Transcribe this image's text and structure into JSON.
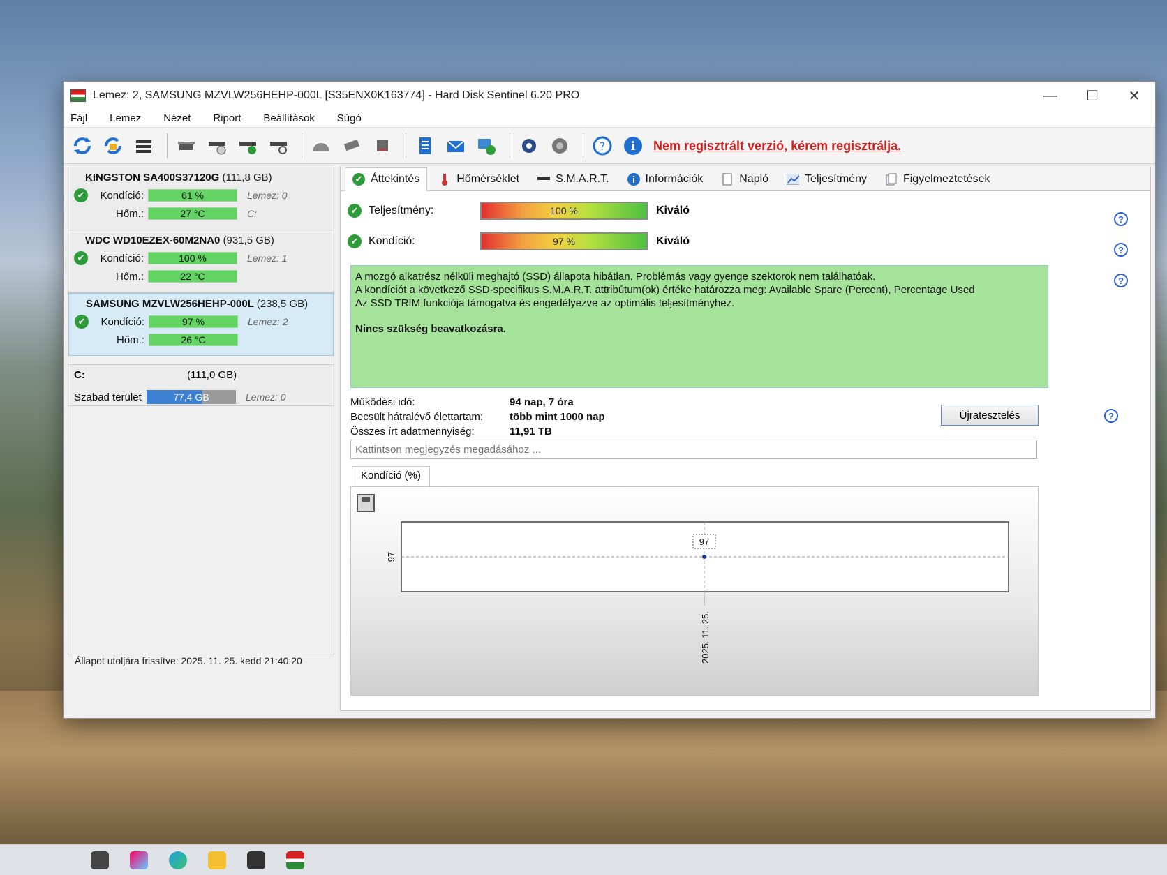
{
  "window": {
    "title": "Lemez: 2, SAMSUNG MZVLW256HEHP-000L [S35ENX0K163774]  -  Hard Disk Sentinel 6.20 PRO",
    "minimize": "—",
    "maximize": "☐",
    "close": "✕"
  },
  "menu": [
    "Fájl",
    "Lemez",
    "Nézet",
    "Riport",
    "Beállítások",
    "Súgó"
  ],
  "toolbar": {
    "registration_notice": "Nem regisztrált verzió, kérem regisztrálja."
  },
  "disks": [
    {
      "name": "KINGSTON SA400S37120G",
      "size": "(111,8 GB)",
      "condition_label": "Kondíció:",
      "condition": "61 %",
      "temp_label": "Hőm.:",
      "temp": "27 °C",
      "disk_meta": "Lemez: 0",
      "drive_meta": "C:"
    },
    {
      "name": "WDC WD10EZEX-60M2NA0",
      "size": "(931,5 GB)",
      "condition_label": "Kondíció:",
      "condition": "100 %",
      "temp_label": "Hőm.:",
      "temp": "22 °C",
      "disk_meta": "Lemez: 1",
      "drive_meta": ""
    },
    {
      "name": "SAMSUNG MZVLW256HEHP-000L",
      "size": "(238,5 GB)",
      "condition_label": "Kondíció:",
      "condition": "97 %",
      "temp_label": "Hőm.:",
      "temp": "26 °C",
      "disk_meta": "Lemez: 2",
      "drive_meta": ""
    }
  ],
  "volume": {
    "letter": "C:",
    "size": "(111,0 GB)",
    "free_label": "Szabad terület",
    "free_value": "77,4 GB",
    "disk_meta": "Lemez: 0"
  },
  "status_bar": "Állapot utoljára frissítve: 2025. 11. 25. kedd 21:40:20",
  "tabs": [
    "Áttekintés",
    "Hőmérséklet",
    "S.M.A.R.T.",
    "Információk",
    "Napló",
    "Teljesítmény",
    "Figyelmeztetések"
  ],
  "overview": {
    "performance_label": "Teljesítmény:",
    "performance_value": "100 %",
    "performance_rating": "Kiváló",
    "condition_label": "Kondíció:",
    "condition_value": "97 %",
    "condition_rating": "Kiváló",
    "status_lines": [
      "A mozgó alkatrész nélküli meghajtó (SSD) állapota hibátlan. Problémás vagy gyenge szektorok nem találhatóak.",
      "A kondíciót a következő SSD-specifikus S.M.A.R.T. attribútum(ok) értéke határozza meg:  Available Spare (Percent), Percentage Used",
      "Az SSD TRIM funkciója támogatva és engedélyezve az optimális teljesítményhez."
    ],
    "status_action": "Nincs szükség beavatkozásra.",
    "uptime_label": "Működési idő:",
    "uptime_value": "94 nap, 7 óra",
    "lifetime_label": "Becsült hátralévő élettartam:",
    "lifetime_value": "több mint 1000 nap",
    "written_label": "Összes írt adatmennyiség:",
    "written_value": "11,91 TB",
    "retest_button": "Újratesztelés",
    "note_placeholder": "Kattintson megjegyzés megadásához ...",
    "chart_tab": "Kondíció  (%)"
  },
  "chart_data": {
    "type": "line",
    "x": [
      "2025. 11. 25."
    ],
    "series": [
      {
        "values": [
          97
        ]
      }
    ],
    "y_tick": "97",
    "point_label": "97",
    "ylim": [
      96,
      98
    ],
    "grid": true
  },
  "colors": {
    "good": "#63d463",
    "status_bg": "#a6e39a",
    "notice": "#d21c1c",
    "selected": "#d7ebf7"
  }
}
